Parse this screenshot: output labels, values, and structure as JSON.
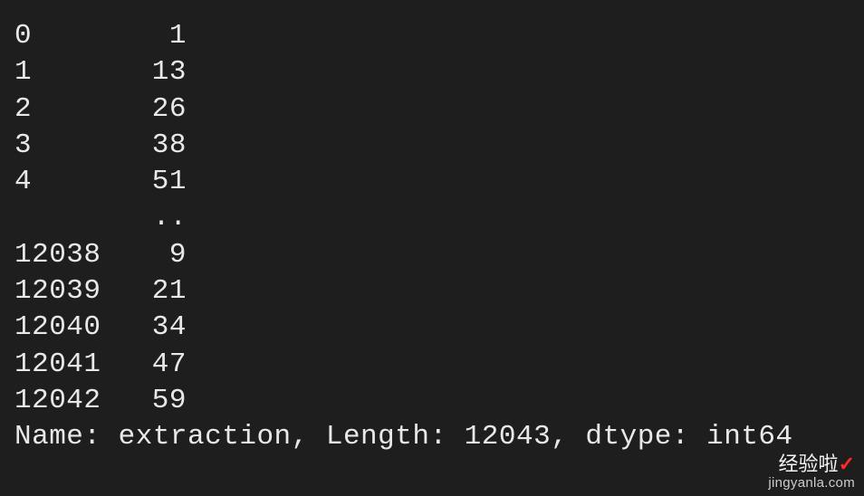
{
  "series": {
    "head": [
      {
        "idx": "0",
        "val": "1"
      },
      {
        "idx": "1",
        "val": "13"
      },
      {
        "idx": "2",
        "val": "26"
      },
      {
        "idx": "3",
        "val": "38"
      },
      {
        "idx": "4",
        "val": "51"
      }
    ],
    "ellipsis": "..",
    "tail": [
      {
        "idx": "12038",
        "val": "9"
      },
      {
        "idx": "12039",
        "val": "21"
      },
      {
        "idx": "12040",
        "val": "34"
      },
      {
        "idx": "12041",
        "val": "47"
      },
      {
        "idx": "12042",
        "val": "59"
      }
    ],
    "summary": "Name: extraction, Length: 12043, dtype: int64"
  },
  "watermark": {
    "line1_a": "经验啦",
    "line1_b": "✓",
    "line2": "jingyanla.com"
  }
}
